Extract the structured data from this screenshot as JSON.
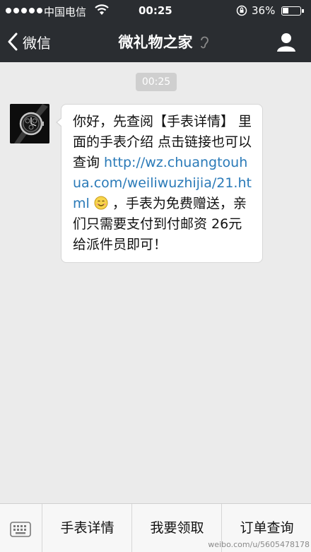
{
  "status_bar": {
    "carrier": "中国电信",
    "time": "00:25",
    "battery_percent": "36%",
    "battery_level": 0.36
  },
  "nav": {
    "back_label": "微信",
    "title": "微礼物之家"
  },
  "chat": {
    "timestamp": "00:25",
    "message": {
      "text_before_link": "你好，先查阅【手表详情】 里面的手表介绍  点击链接也可以查询 ",
      "link": "http://wz.chuangtouhua.com/weiliwuzhijia/21.html",
      "emoji": "smiley-icon",
      "text_after_link": " ，手表为免费赠送，亲们只需要支付到付邮资 26元给派件员即可！"
    }
  },
  "bottom_menu": {
    "items": [
      {
        "label": "手表详情"
      },
      {
        "label": "我要领取"
      },
      {
        "label": "订单查询"
      }
    ]
  },
  "watermark": "weibo.com/u/5605478178",
  "colors": {
    "header_bg": "#2a2d31",
    "chat_bg": "#ebebeb",
    "link": "#2a7ab8"
  }
}
